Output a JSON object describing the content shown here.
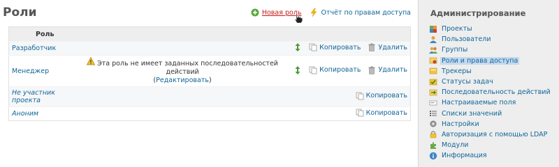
{
  "page": {
    "title": "Роли"
  },
  "actions": {
    "new_role": "Новая роль",
    "report": "Отчёт по правам доступа"
  },
  "table": {
    "header": "Роль",
    "rows": [
      {
        "name": "Разработчик",
        "italic": false,
        "warning": "",
        "warning_link": "",
        "reorder": true,
        "copy": "Копировать",
        "delete": "Удалить"
      },
      {
        "name": "Менеджер",
        "italic": false,
        "warning": "Эта роль не имеет заданных последовательностей действий",
        "warning_link": "Редактировать",
        "reorder": true,
        "copy": "Копировать",
        "delete": "Удалить"
      },
      {
        "name": "Не участник проекта",
        "italic": true,
        "warning": "",
        "warning_link": "",
        "reorder": false,
        "copy": "Копировать",
        "delete": ""
      },
      {
        "name": "Аноним",
        "italic": true,
        "warning": "",
        "warning_link": "",
        "reorder": false,
        "copy": "Копировать",
        "delete": ""
      }
    ]
  },
  "sidebar": {
    "title": "Администрирование",
    "items": [
      {
        "label": "Проекты",
        "icon": "projects-icon",
        "selected": false
      },
      {
        "label": "Пользователи",
        "icon": "users-icon",
        "selected": false
      },
      {
        "label": "Группы",
        "icon": "groups-icon",
        "selected": false
      },
      {
        "label": "Роли и права доступа",
        "icon": "roles-icon",
        "selected": true
      },
      {
        "label": "Трекеры",
        "icon": "trackers-icon",
        "selected": false
      },
      {
        "label": "Статусы задач",
        "icon": "issue-statuses-icon",
        "selected": false
      },
      {
        "label": "Последовательность действий",
        "icon": "workflows-icon",
        "selected": false
      },
      {
        "label": "Настраиваемые поля",
        "icon": "custom-fields-icon",
        "selected": false
      },
      {
        "label": "Списки значений",
        "icon": "enumerations-icon",
        "selected": false
      },
      {
        "label": "Настройки",
        "icon": "settings-icon",
        "selected": false
      },
      {
        "label": "Авторизация с помощью LDAP",
        "icon": "ldap-icon",
        "selected": false
      },
      {
        "label": "Модули",
        "icon": "plugins-icon",
        "selected": false
      },
      {
        "label": "Информация",
        "icon": "info-icon",
        "selected": false
      }
    ]
  }
}
